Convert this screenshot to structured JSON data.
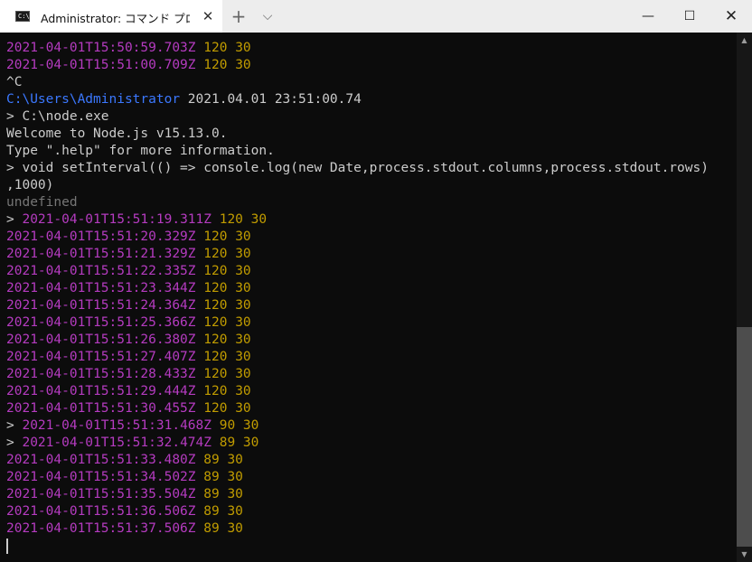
{
  "window": {
    "tab_title": "Administrator: コマンド プロンプト - ",
    "tab_icon_text": "C:\\",
    "tab_close": "✕",
    "new_tab": "+",
    "dropdown": "⌵",
    "minimize": "—",
    "maximize": "☐",
    "close": "✕"
  },
  "terminal": {
    "lines": [
      {
        "prompt": "",
        "ts": "2021-04-01T15:50:59.703Z",
        "cols": "120",
        "rows": "30"
      },
      {
        "prompt": "",
        "ts": "2021-04-01T15:51:00.709Z",
        "cols": "120",
        "rows": "30"
      },
      {
        "plain": "^C"
      },
      {
        "path": "C:\\Users\\Administrator",
        "stamp": " 2021.04.01 23:51:00.74"
      },
      {
        "plain": "> C:\\node.exe"
      },
      {
        "plain": "Welcome to Node.js v15.13.0."
      },
      {
        "plain": "Type \".help\" for more information."
      },
      {
        "plain": "> void setInterval(() => console.log(new Date,process.stdout.columns,process.stdout.rows)"
      },
      {
        "plain": ",1000)"
      },
      {
        "gray": "undefined"
      },
      {
        "prompt": "> ",
        "ts": "2021-04-01T15:51:19.311Z",
        "cols": "120",
        "rows": "30"
      },
      {
        "prompt": "",
        "ts": "2021-04-01T15:51:20.329Z",
        "cols": "120",
        "rows": "30"
      },
      {
        "prompt": "",
        "ts": "2021-04-01T15:51:21.329Z",
        "cols": "120",
        "rows": "30"
      },
      {
        "prompt": "",
        "ts": "2021-04-01T15:51:22.335Z",
        "cols": "120",
        "rows": "30"
      },
      {
        "prompt": "",
        "ts": "2021-04-01T15:51:23.344Z",
        "cols": "120",
        "rows": "30"
      },
      {
        "prompt": "",
        "ts": "2021-04-01T15:51:24.364Z",
        "cols": "120",
        "rows": "30"
      },
      {
        "prompt": "",
        "ts": "2021-04-01T15:51:25.366Z",
        "cols": "120",
        "rows": "30"
      },
      {
        "prompt": "",
        "ts": "2021-04-01T15:51:26.380Z",
        "cols": "120",
        "rows": "30"
      },
      {
        "prompt": "",
        "ts": "2021-04-01T15:51:27.407Z",
        "cols": "120",
        "rows": "30"
      },
      {
        "prompt": "",
        "ts": "2021-04-01T15:51:28.433Z",
        "cols": "120",
        "rows": "30"
      },
      {
        "prompt": "",
        "ts": "2021-04-01T15:51:29.444Z",
        "cols": "120",
        "rows": "30"
      },
      {
        "prompt": "",
        "ts": "2021-04-01T15:51:30.455Z",
        "cols": "120",
        "rows": "30"
      },
      {
        "prompt": "> ",
        "ts": "2021-04-01T15:51:31.468Z",
        "cols": "90",
        "rows": "30"
      },
      {
        "prompt": "> ",
        "ts": "2021-04-01T15:51:32.474Z",
        "cols": "89",
        "rows": "30"
      },
      {
        "prompt": "",
        "ts": "2021-04-01T15:51:33.480Z",
        "cols": "89",
        "rows": "30"
      },
      {
        "prompt": "",
        "ts": "2021-04-01T15:51:34.502Z",
        "cols": "89",
        "rows": "30"
      },
      {
        "prompt": "",
        "ts": "2021-04-01T15:51:35.504Z",
        "cols": "89",
        "rows": "30"
      },
      {
        "prompt": "",
        "ts": "2021-04-01T15:51:36.506Z",
        "cols": "89",
        "rows": "30"
      },
      {
        "prompt": "",
        "ts": "2021-04-01T15:51:37.506Z",
        "cols": "89",
        "rows": "30"
      }
    ]
  },
  "scrollbar": {
    "up": "▲",
    "down": "▼"
  },
  "colors": {
    "background": "#0c0c0c",
    "text": "#cccccc",
    "timestamp": "#b53bc0",
    "number": "#c19c00",
    "path": "#3b78ff",
    "undefined": "#767676"
  }
}
